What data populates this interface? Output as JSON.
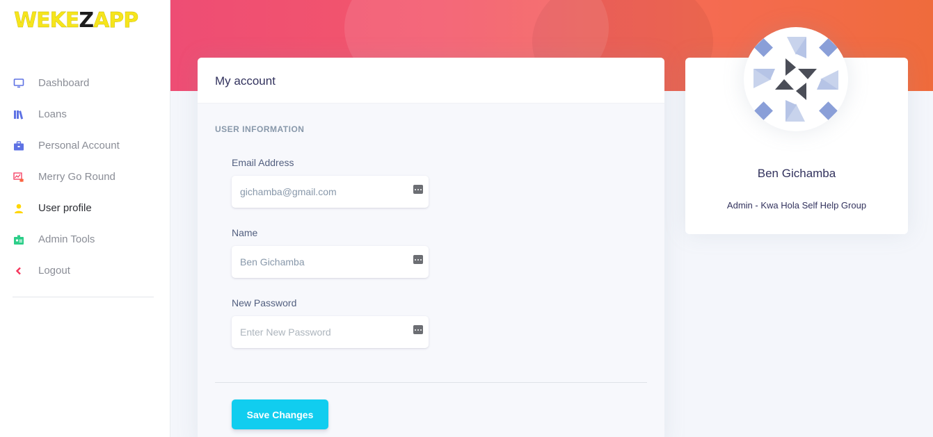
{
  "brand": {
    "part1": "WEKE",
    "part2": "Z",
    "part3": "APP"
  },
  "sidebar": {
    "items": [
      {
        "label": "Dashboard",
        "icon": "monitor-icon",
        "color": "#5e72e4"
      },
      {
        "label": "Loans",
        "icon": "books-icon",
        "color": "#5e72e4"
      },
      {
        "label": "Personal Account",
        "icon": "briefcase-icon",
        "color": "#5e72e4"
      },
      {
        "label": "Merry Go Round",
        "icon": "chart-coins-icon",
        "color": "#f5365c"
      },
      {
        "label": "User profile",
        "icon": "user-icon",
        "color": "#ffd600"
      },
      {
        "label": "Admin Tools",
        "icon": "id-badge-icon",
        "color": "#2dce89"
      },
      {
        "label": "Logout",
        "icon": "chevron-left-icon",
        "color": "#f5365c"
      }
    ],
    "active_index": 4
  },
  "account": {
    "title": "My account",
    "section_heading": "USER INFORMATION",
    "fields": {
      "email": {
        "label": "Email Address",
        "value": "gichamba@gmail.com"
      },
      "name": {
        "label": "Name",
        "value": "Ben Gichamba"
      },
      "password": {
        "label": "New Password",
        "placeholder": "Enter New Password"
      }
    },
    "save_label": "Save Changes"
  },
  "profile": {
    "name": "Ben Gichamba",
    "role": "Admin - Kwa Hola Self Help Group"
  },
  "colors": {
    "accent": "#11cdef",
    "header_gradient_start": "#ee4d74",
    "header_gradient_end": "#ef6b3c"
  }
}
